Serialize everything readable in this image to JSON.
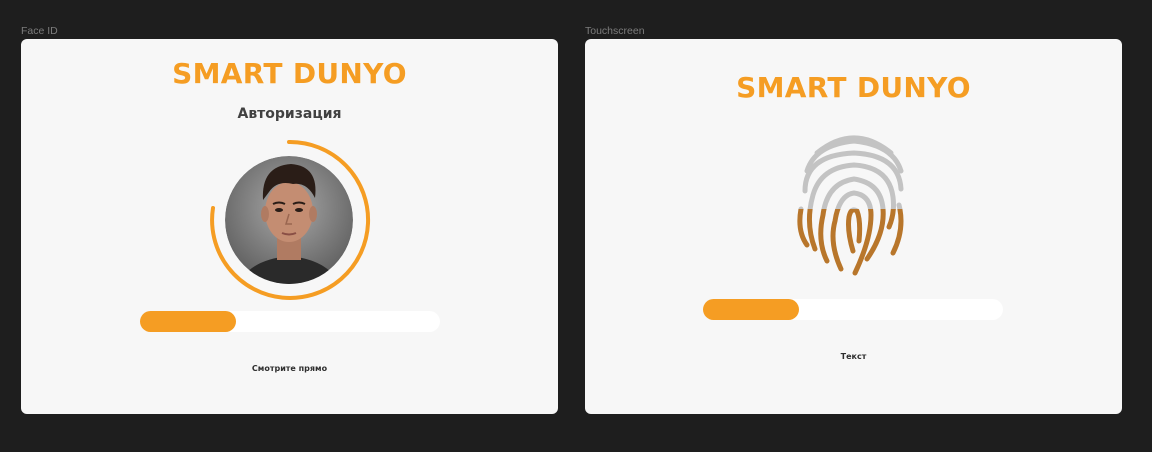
{
  "frames": [
    {
      "label": "Face ID",
      "brand": "SMART DUNYO",
      "subtitle": "Авторизация",
      "progress": 0.32,
      "caption": "Смотрите прямо",
      "avatar": "user-face-photo"
    },
    {
      "label": "Touchscreen",
      "brand": "SMART DUNYO",
      "progress": 0.32,
      "caption": "Текст",
      "icon": "fingerprint-icon"
    }
  ],
  "colors": {
    "accent": "#f59d23",
    "fingerprint_scanned": "#b8762b",
    "fingerprint_pending": "#c3c3c3",
    "frame_bg": "#f7f7f7",
    "canvas_bg": "#1e1e1e"
  }
}
